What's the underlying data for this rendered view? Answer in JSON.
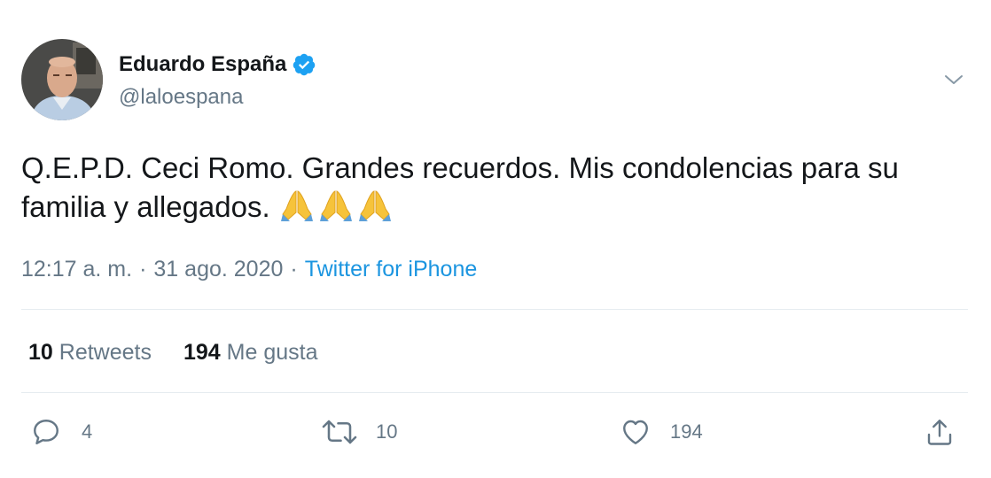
{
  "tweet": {
    "author": {
      "display_name": "Eduardo España",
      "handle": "@laloespana",
      "verified": true
    },
    "text": "Q.E.P.D. Ceci Romo. Grandes recuerdos. Mis condolencias para su familia y allegados.",
    "emojis": [
      "🙏",
      "🙏",
      "🙏"
    ],
    "time": "12:17 a. m.",
    "separator": "·",
    "date": "31 ago. 2020",
    "source": "Twitter for iPhone",
    "stats": {
      "retweets_count": "10",
      "retweets_label": "Retweets",
      "likes_count": "194",
      "likes_label": "Me gusta"
    },
    "actions": {
      "reply_count": "4",
      "retweet_count": "10",
      "like_count": "194"
    }
  },
  "colors": {
    "text_primary": "#14171a",
    "text_secondary": "#657786",
    "link": "#1b95e0",
    "verified": "#1da1f2",
    "divider": "#e6ecf0"
  },
  "icons": {
    "verified": "verified-badge-icon",
    "menu": "chevron-down-icon",
    "reply": "reply-icon",
    "retweet": "retweet-icon",
    "like": "heart-icon",
    "share": "share-icon",
    "emoji": "folded-hands-icon"
  }
}
